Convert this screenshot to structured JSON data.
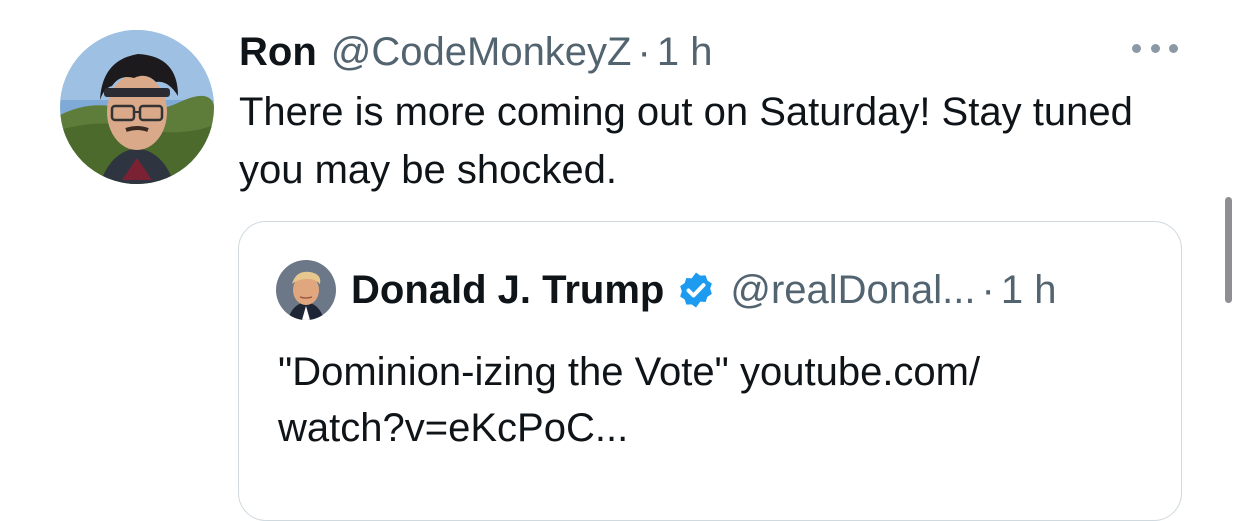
{
  "tweet": {
    "author_name": "Ron",
    "author_handle": "@CodeMonkeyZ",
    "separator": "·",
    "time": "1 h",
    "text": "There is more coming out on Saturday! Stay tuned you may be shocked."
  },
  "quoted_tweet": {
    "author_name": "Donald J. Trump",
    "author_handle": "@realDonal...",
    "separator": "·",
    "time": "1 h",
    "text": "\"Dominion-izing the Vote\" youtube.com/\nwatch?v=eKcPoC..."
  },
  "icons": {
    "more": "more-horizontal-icon",
    "verified": "verified-badge-icon"
  },
  "colors": {
    "text": "#0f1419",
    "secondary": "#536471",
    "verified": "#1d9bf0",
    "border": "#cfd9de"
  }
}
